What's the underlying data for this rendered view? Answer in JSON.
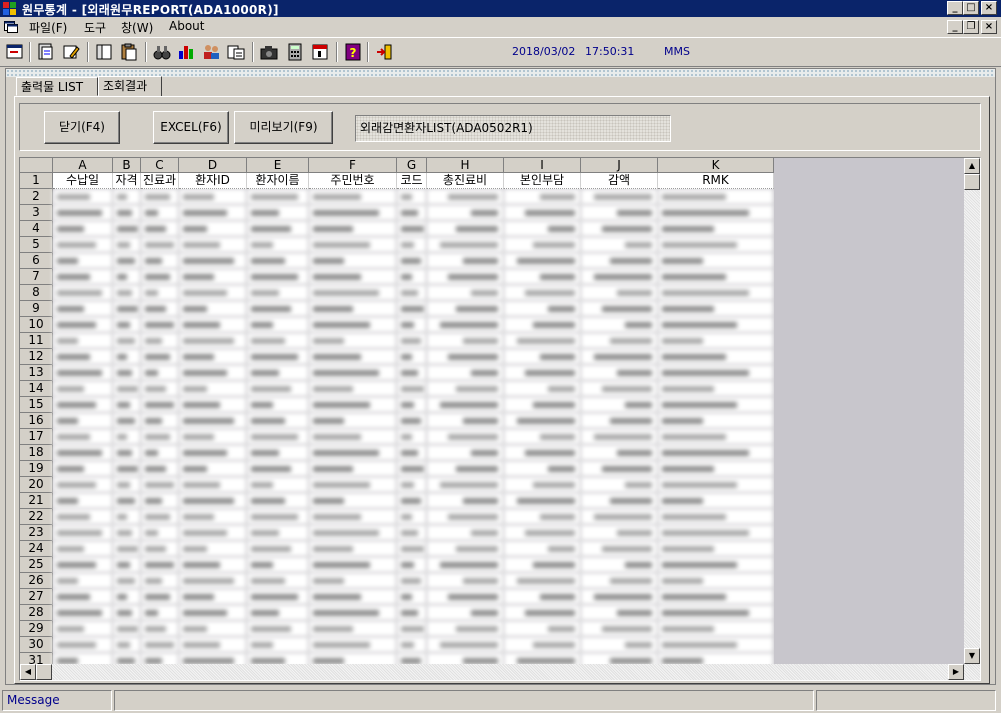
{
  "window": {
    "title": "원무통계 - [외래원무REPORT(ADA1000R)]",
    "minimize_glyph": "_",
    "maximize_glyph": "□",
    "close_glyph": "×",
    "restore_glyph": "❐"
  },
  "menu": {
    "items": [
      {
        "label": "파일(F)"
      },
      {
        "label": "도구"
      },
      {
        "label": "창(W)"
      },
      {
        "label": "About"
      }
    ]
  },
  "toolbar": {
    "date": "2018/03/02",
    "time": "17:50:31",
    "user": "MMS"
  },
  "tabs": [
    {
      "label": "출력물 LIST"
    },
    {
      "label": "조회결과"
    }
  ],
  "buttons": {
    "close": "닫기(F4)",
    "excel": "EXCEL(F6)",
    "preview": "미리보기(F9)"
  },
  "report_name": "외래감면환자LIST(ADA0502R1)",
  "grid": {
    "columns": [
      "A",
      "B",
      "C",
      "D",
      "E",
      "F",
      "G",
      "H",
      "I",
      "J",
      "K"
    ],
    "header_row": [
      "수납일",
      "자격",
      "진료과",
      "환자ID",
      "환자이름",
      "주민번호",
      "코드",
      "총진료비",
      "본인부담",
      "감액",
      "RMK"
    ],
    "row_numbers": [
      "1",
      "2",
      "3",
      "4",
      "5",
      "6",
      "7",
      "8",
      "9",
      "10",
      "11",
      "12",
      "13",
      "14",
      "15",
      "16",
      "17",
      "18",
      "19",
      "20",
      "21",
      "22",
      "23",
      "24",
      "25",
      "26",
      "27",
      "28",
      "29",
      "30",
      "31"
    ]
  },
  "statusbar": {
    "message": "Message"
  }
}
